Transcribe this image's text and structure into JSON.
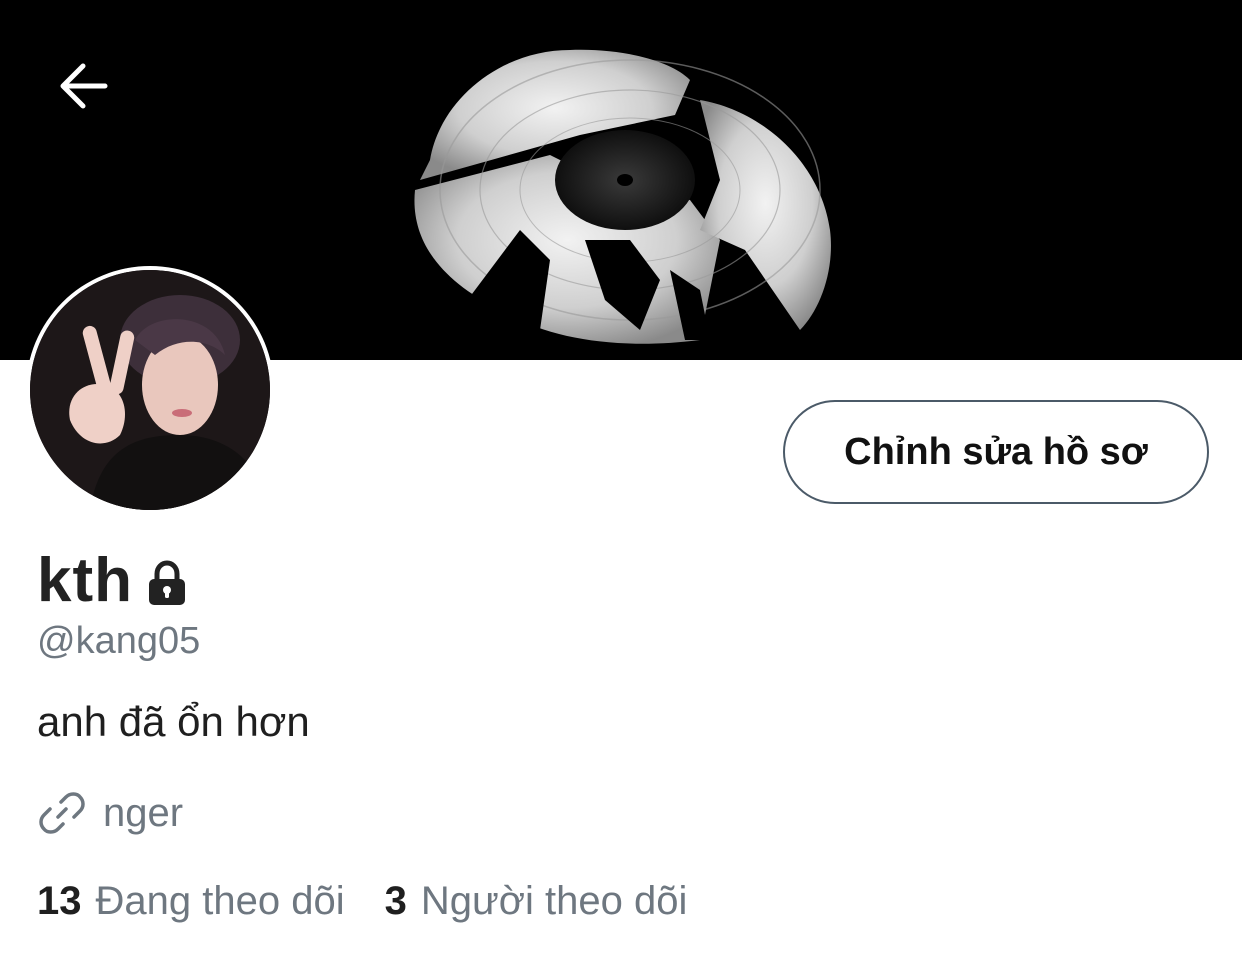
{
  "header": {
    "back_icon": "arrow-left-icon",
    "banner_image": "broken-vinyl-record"
  },
  "profile": {
    "display_name": "kth",
    "protected_icon": "lock-icon",
    "handle": "@kang05",
    "bio": "anh đã ổn hơn",
    "link_icon": "link-icon",
    "link_text": "nger",
    "edit_button_label": "Chỉnh sửa hồ sơ"
  },
  "stats": {
    "following_count": "13",
    "following_label": "Đang theo dõi",
    "followers_count": "3",
    "followers_label": "Người theo dõi"
  },
  "colors": {
    "banner_bg": "#000000",
    "secondary_text": "#6e7780",
    "button_border": "#4b5a68"
  }
}
